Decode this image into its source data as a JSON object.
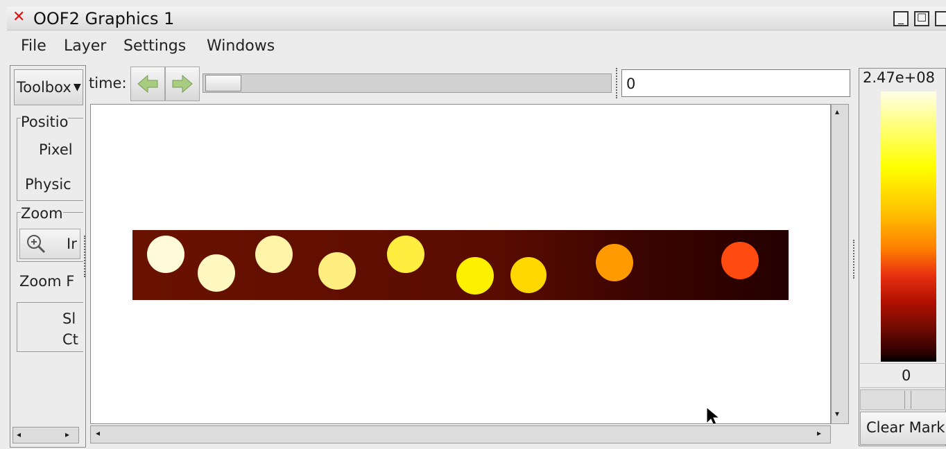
{
  "window": {
    "title": "OOF2 Graphics 1",
    "close_glyph": "✕",
    "minimize_glyph": "_",
    "maximize_glyph": "☐"
  },
  "menu": [
    "File",
    "Layer",
    "Settings",
    "Windows"
  ],
  "toolbox": {
    "selector_label": "Toolbox",
    "position_frame": "Positio",
    "pixel_label": "Pixel",
    "physical_label": "Physic",
    "zoom_frame": "Zoom",
    "zoom_in_label": "Ir",
    "zoom_factor_label": "Zoom F",
    "show_ctrl_line1": "Sl",
    "show_ctrl_line2": "Ct"
  },
  "time": {
    "label": "time:",
    "value": "0",
    "prev_icon": "left-arrow-icon",
    "next_icon": "right-arrow-icon"
  },
  "colorbar": {
    "max_label": "2.47e+08",
    "min_label": "0",
    "clear_mark_label": "Clear Mark"
  },
  "canvas": {
    "background": "#ffffff",
    "strip_color": "#5a0e00"
  }
}
